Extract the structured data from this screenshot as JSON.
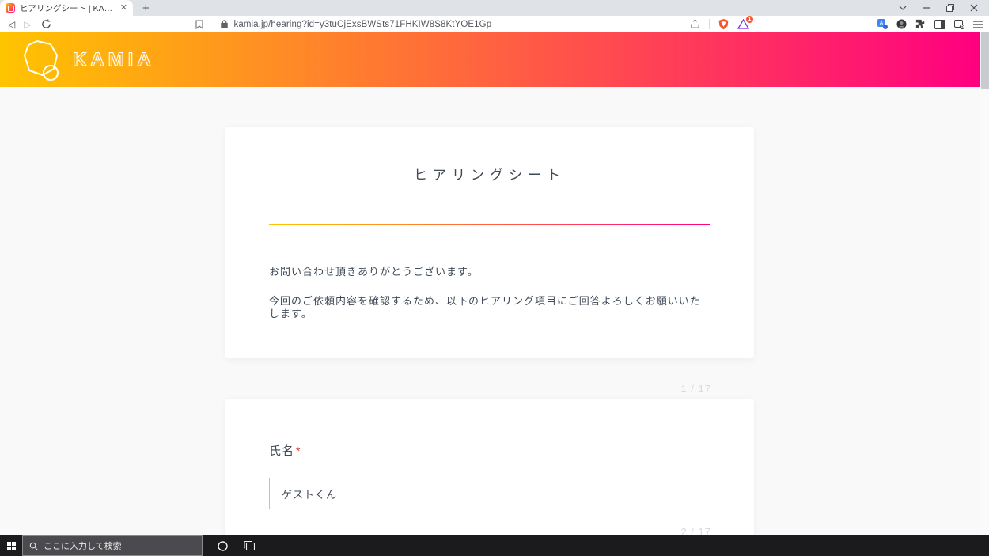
{
  "browser": {
    "tab_title": "ヒアリングシート | KAMIA",
    "url": "kamia.jp/hearing?id=y3tuCjExsBWSts71FHKIW8S8KtYOE1Gp",
    "rewards_badge_count": "1",
    "icons": {
      "close_tab": "✕",
      "new_tab": "+",
      "back": "◁",
      "forward": "▷"
    }
  },
  "site_header": {
    "brand": "KAMIA",
    "gradient_start": "#ffc400",
    "gradient_end": "#ff0080"
  },
  "intro_card": {
    "title": "ヒアリングシート",
    "paragraph1": "お問い合わせ頂きありがとうございます。",
    "paragraph2": "今回のご依頼内容を確認するため、以下のヒアリング項目にご回答よろしくお願いいたします。"
  },
  "question1": {
    "indicator": "1 / 17",
    "label": "氏名",
    "required_mark": "*",
    "value": "ゲストくん"
  },
  "question2": {
    "indicator": "2 / 17"
  },
  "taskbar": {
    "search_placeholder": "ここに入力して検索"
  }
}
